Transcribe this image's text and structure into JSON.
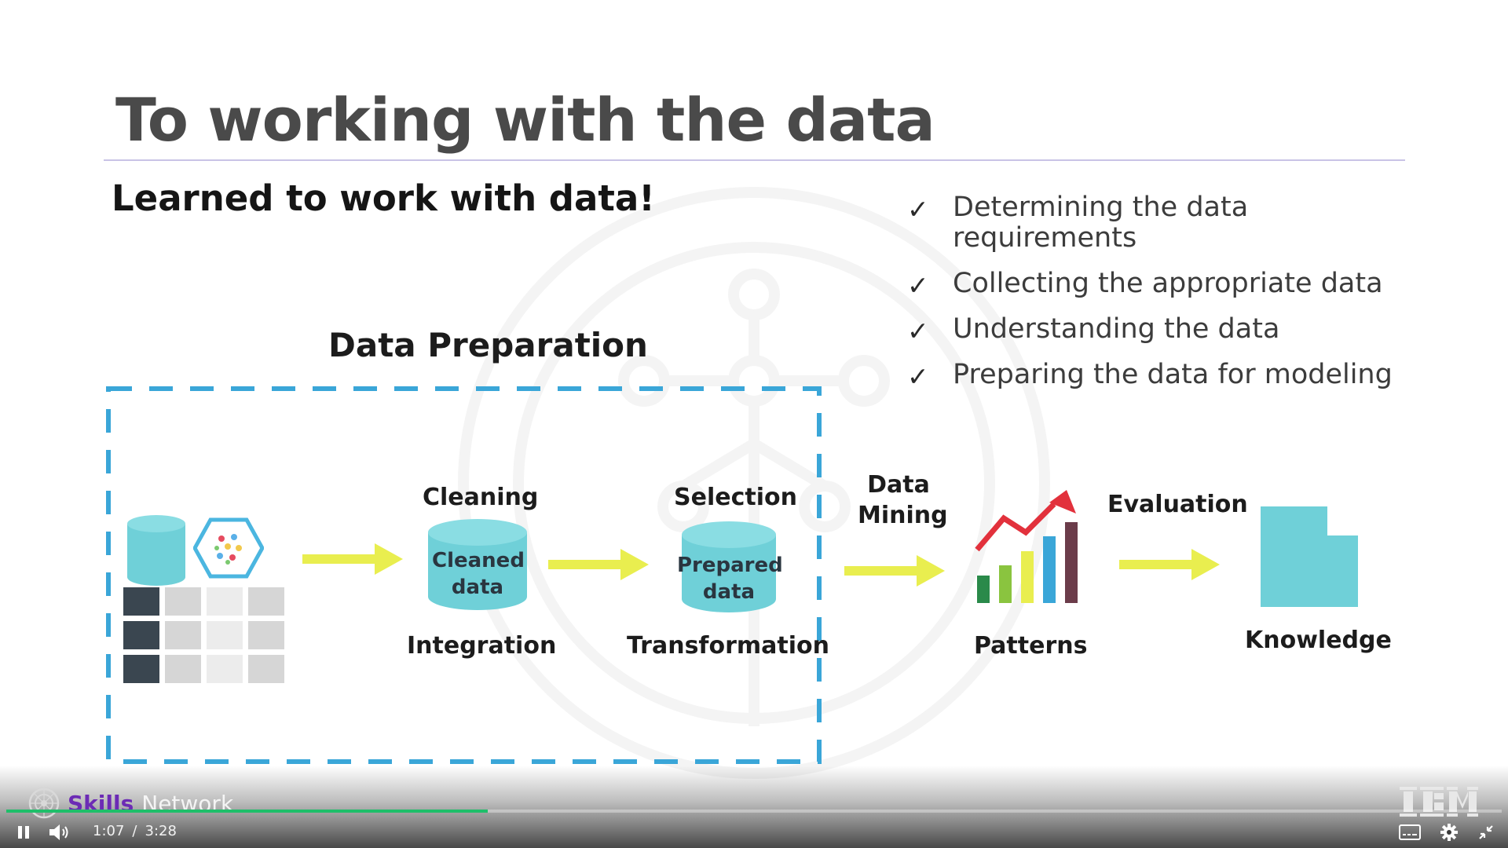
{
  "slide": {
    "title": "To working with the data",
    "subtitle": "Learned to work with data!",
    "checklist": [
      "Determining the data requirements",
      "Collecting the appropriate data",
      "Understanding the data",
      "Preparing the data for modeling"
    ],
    "check_glyph": "✓",
    "diagram": {
      "section_title": "Data Preparation",
      "cleaning_label": "Cleaning",
      "cleaned_data_line1": "Cleaned",
      "cleaned_data_line2": "data",
      "integration_label": "Integration",
      "selection_label": "Selection",
      "prepared_data_line1": "Prepared",
      "prepared_data_line2": "data",
      "transformation_label": "Transformation",
      "data_mining_line1": "Data",
      "data_mining_line2": "Mining",
      "patterns_label": "Patterns",
      "evaluation_label": "Evaluation",
      "knowledge_label": "Knowledge",
      "colors": {
        "cylinder": "#6fd0d8",
        "arrow": "#e9ee4f",
        "dash": "#3aa6d8",
        "table_dark": "#3a4650"
      }
    }
  },
  "brand": {
    "skills": "Skills",
    "network": "Network"
  },
  "player": {
    "current_time": "1:07",
    "separator": "/",
    "duration": "3:28",
    "progress_fraction": 0.322,
    "icons": [
      "pause-icon",
      "volume-icon",
      "captions-icon",
      "settings-icon",
      "exit-fullscreen-icon"
    ],
    "accent": "#1fbf6a"
  }
}
